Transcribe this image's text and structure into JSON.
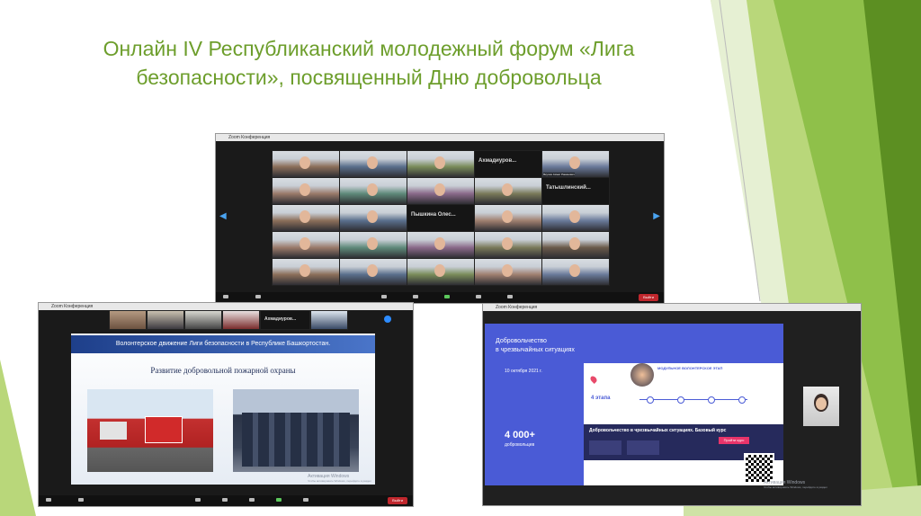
{
  "slide_title": "Онлайн IV Республиканский молодежный форум «Лига безопасности», посвященный Дню добровольца",
  "colors": {
    "title": "#6d9e2c",
    "green_light": "#b9d77a",
    "green_dark": "#5c8f22",
    "zoom_bar": "#111111",
    "end_red": "#c0272d",
    "rescue_blue": "#4a5bd6"
  },
  "shot1": {
    "window_title": "Zoom Конференция",
    "tiles": [
      {
        "name": "",
        "kind": "video"
      },
      {
        "name": "",
        "kind": "video"
      },
      {
        "name": "",
        "kind": "video"
      },
      {
        "name": "Ахмадиуров...",
        "kind": "named"
      },
      {
        "name": "Якупов Ахмат Ракинович",
        "kind": "video"
      },
      {
        "name": "",
        "kind": "video"
      },
      {
        "name": "",
        "kind": "video"
      },
      {
        "name": "",
        "kind": "video"
      },
      {
        "name": "",
        "kind": "video"
      },
      {
        "name": "Татышлинский...",
        "kind": "named"
      },
      {
        "name": "",
        "kind": "video"
      },
      {
        "name": "",
        "kind": "video"
      },
      {
        "name": "Пышкина Олес...",
        "kind": "named"
      },
      {
        "name": "",
        "kind": "video"
      },
      {
        "name": "",
        "kind": "video"
      },
      {
        "name": "",
        "kind": "video"
      },
      {
        "name": "",
        "kind": "video"
      },
      {
        "name": "",
        "kind": "video"
      },
      {
        "name": "",
        "kind": "video"
      },
      {
        "name": "",
        "kind": "video"
      },
      {
        "name": "",
        "kind": "video"
      },
      {
        "name": "",
        "kind": "video"
      },
      {
        "name": "",
        "kind": "video"
      },
      {
        "name": "",
        "kind": "video"
      },
      {
        "name": "",
        "kind": "video"
      }
    ],
    "end_label": "Выйти"
  },
  "shot2": {
    "window_title": "Zoom Конференция",
    "header_tile": "Ахмадиуров...",
    "slide_banner": "Волонтерское движение Лиги безопасности в Республике Башкортостан.",
    "slide_heading": "Развитие добровольной пожарной охраны",
    "watermark1": "Активация Windows",
    "watermark2": "Чтобы активировать Windows, перейдите в раздел",
    "end_label": "Выйти"
  },
  "shot3": {
    "window_title": "Zoom Конференция",
    "rescue_title1": "Добровольчество",
    "rescue_title2": "в чрезвычайных ситуациях",
    "date_text": "10 октября 2021 г.",
    "module_header": "МОДУЛЬНОЕ ВОЛОНТЕРСКОЕ ЭТАП",
    "stage_count": "4 этапа",
    "volunteers_count": "4 000+",
    "volunteers_label": "добровольцев",
    "course_bar": "Добровольчество в чрезвычайных ситуациях. Базовый курс",
    "course_button": "Пройти курс",
    "watermark1": "Активация Windows",
    "watermark2": "Чтобы активировать Windows, перейдите в раздел"
  }
}
